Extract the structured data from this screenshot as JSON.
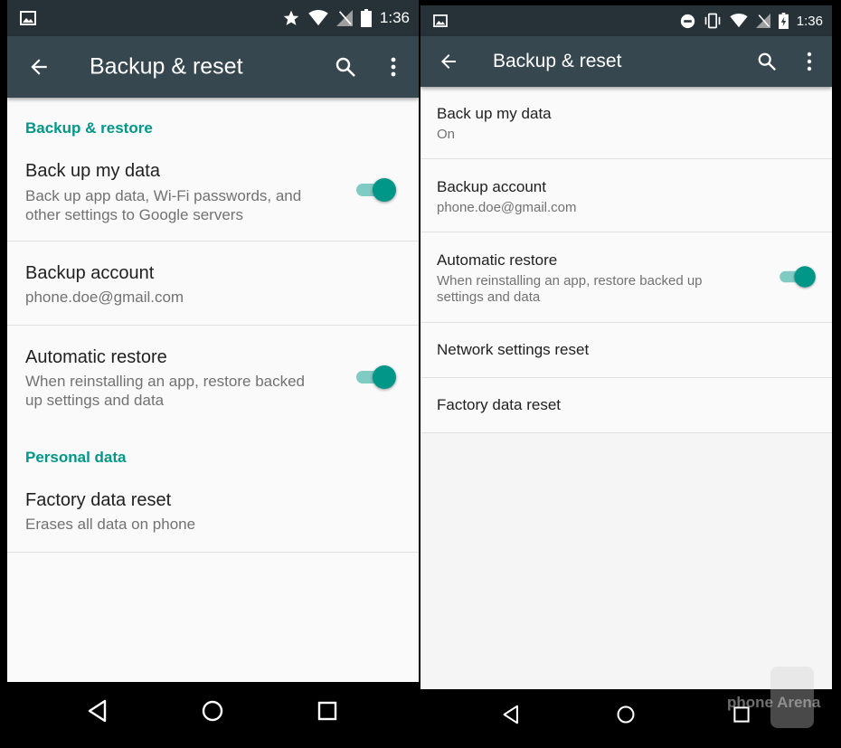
{
  "left": {
    "status": {
      "time": "1:36"
    },
    "appbar": {
      "title": "Backup & reset"
    },
    "sections": {
      "backup_restore": "Backup & restore",
      "personal_data": "Personal data"
    },
    "items": {
      "backup_data": {
        "title": "Back up my data",
        "subtitle": "Back up app data, Wi-Fi passwords, and other settings to Google servers",
        "enabled": true
      },
      "backup_account": {
        "title": "Backup account",
        "subtitle": "phone.doe@gmail.com"
      },
      "auto_restore": {
        "title": "Automatic restore",
        "subtitle": "When reinstalling an app, restore backed up settings and data",
        "enabled": true
      },
      "factory_reset": {
        "title": "Factory data reset",
        "subtitle": "Erases all data on phone"
      }
    }
  },
  "right": {
    "status": {
      "time": "1:36"
    },
    "appbar": {
      "title": "Backup & reset"
    },
    "items": {
      "backup_data": {
        "title": "Back up my data",
        "subtitle": "On"
      },
      "backup_account": {
        "title": "Backup account",
        "subtitle": "phone.doe@gmail.com"
      },
      "auto_restore": {
        "title": "Automatic restore",
        "subtitle": "When reinstalling an app, restore backed up settings and data",
        "enabled": true
      },
      "network_reset": {
        "title": "Network settings reset"
      },
      "factory_reset": {
        "title": "Factory data reset"
      }
    }
  },
  "watermark": {
    "text": "phone Arena"
  },
  "colors": {
    "statusbar": "#263238",
    "appbar": "#37474f",
    "accent": "#009688",
    "toggle_track": "#80cbc4",
    "background": "#fafafa"
  },
  "icons": {
    "status_left": [
      "image-notification-icon",
      "star-icon",
      "wifi-icon",
      "no-signal-icon",
      "battery-icon"
    ],
    "status_right": [
      "image-notification-icon",
      "do-not-disturb-icon",
      "vibrate-icon",
      "wifi-icon",
      "no-signal-icon",
      "battery-charging-icon"
    ],
    "appbar": [
      "back-arrow-icon",
      "search-icon",
      "overflow-menu-icon"
    ],
    "navbar": [
      "back-triangle-icon",
      "home-circle-icon",
      "recents-square-icon"
    ]
  }
}
